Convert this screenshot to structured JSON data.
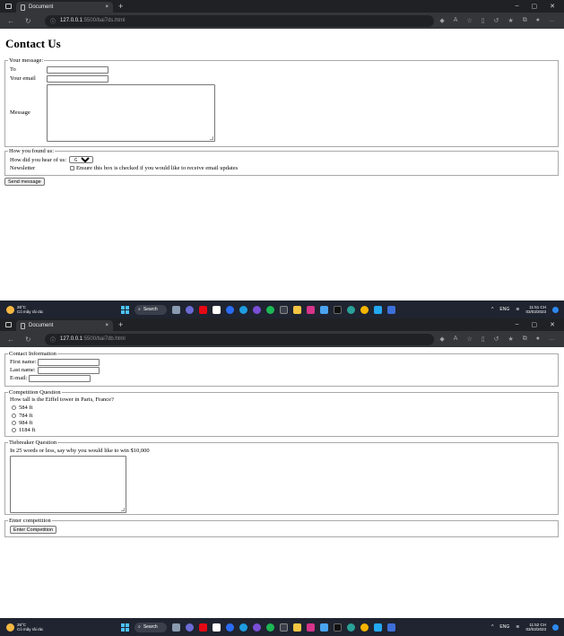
{
  "browser": {
    "tab_title": "Document",
    "tab_close": "×",
    "new_tab": "+",
    "url_host": "127.0.0.1",
    "url_path_1": ":5500/bai7ds.html",
    "url_path_2": ":5500/bai7db.html"
  },
  "form1": {
    "heading": "Contact Us",
    "message_legend": "Your message:",
    "to_label": "To",
    "email_label": "Your email",
    "message_label": "Message",
    "found_legend": "How you found us:",
    "hear_label": "How did you hear of us:",
    "hear_selected": "Google",
    "newsletter_label": "Newsletter",
    "newsletter_text": "Ensure this box is checked if you would like to receive email updates",
    "submit_label": "Send message"
  },
  "form2": {
    "contact_legend": "Contact Information",
    "first_name_label": "First name:",
    "last_name_label": "Last name:",
    "email_label": "E-mail:",
    "question_legend": "Competition Question",
    "question_text": "How tall is the Eiffel tower in Paris, France?",
    "options": [
      "584 ft",
      "784 ft",
      "984 ft",
      "1184 ft"
    ],
    "tiebreaker_legend": "Tiebreaker Question",
    "tiebreaker_text": "In 25 words or less, say why you would like to win $10,000",
    "enter_legend": "Enter competition",
    "enter_button": "Enter Competition"
  },
  "taskbar": {
    "temp": "26°C",
    "weather_desc": "Có mây rải rác",
    "search_label": "Search",
    "lang": "ENG",
    "time_1": "11:51 CH",
    "time_2": "11:52 CH",
    "date": "03/03/2023"
  }
}
